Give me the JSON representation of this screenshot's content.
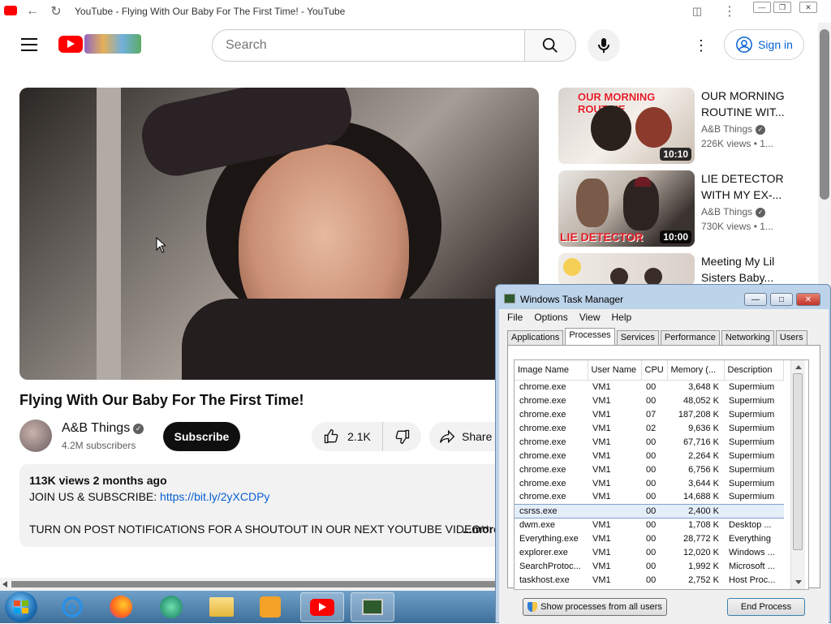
{
  "browser": {
    "title": "YouTube - Flying With Our Baby For The First Time! - YouTube"
  },
  "header": {
    "search_placeholder": "Search",
    "sign_in": "Sign in"
  },
  "video": {
    "title": "Flying With Our Baby For The First Time!",
    "channel": "A&B Things",
    "subscribers": "4.2M subscribers",
    "subscribe_label": "Subscribe",
    "likes": "2.1K",
    "share_label": "Share",
    "views_date": "113K views  2 months ago",
    "desc_line1": "JOIN US & SUBSCRIBE: ",
    "desc_link": "https://bit.ly/2yXCDPy",
    "desc_line2": "TURN ON POST NOTIFICATIONS FOR A SHOUTOUT IN OUR NEXT YOUTUBE VIDEO**",
    "more_label": "...more"
  },
  "suggestions": [
    {
      "title": "OUR MORNING ROUTINE WIT...",
      "channel": "A&B Things",
      "views": "226K views  • 1...",
      "duration": "10:10",
      "thumb_text": "OUR MORNING ROUTINE"
    },
    {
      "title": "LIE DETECTOR WITH MY EX-...",
      "channel": "A&B Things",
      "views": "730K views  • 1...",
      "duration": "10:00",
      "thumb_text": "LIE DETECTOR"
    },
    {
      "title": "Meeting My Lil Sisters Baby...",
      "channel": "",
      "views": "",
      "duration": "",
      "thumb_text": ""
    }
  ],
  "task_manager": {
    "title": "Windows Task Manager",
    "menu": [
      "File",
      "Options",
      "View",
      "Help"
    ],
    "tabs": [
      "Applications",
      "Processes",
      "Services",
      "Performance",
      "Networking",
      "Users"
    ],
    "selected_tab": "Processes",
    "columns": [
      "Image Name",
      "User Name",
      "CPU",
      "Memory (...",
      "Description"
    ],
    "rows": [
      [
        "chrome.exe",
        "VM1",
        "00",
        "3,648 K",
        "Supermium"
      ],
      [
        "chrome.exe",
        "VM1",
        "00",
        "48,052 K",
        "Supermium"
      ],
      [
        "chrome.exe",
        "VM1",
        "07",
        "187,208 K",
        "Supermium"
      ],
      [
        "chrome.exe",
        "VM1",
        "02",
        "9,636 K",
        "Supermium"
      ],
      [
        "chrome.exe",
        "VM1",
        "00",
        "67,716 K",
        "Supermium"
      ],
      [
        "chrome.exe",
        "VM1",
        "00",
        "2,264 K",
        "Supermium"
      ],
      [
        "chrome.exe",
        "VM1",
        "00",
        "6,756 K",
        "Supermium"
      ],
      [
        "chrome.exe",
        "VM1",
        "00",
        "3,644 K",
        "Supermium"
      ],
      [
        "chrome.exe",
        "VM1",
        "00",
        "14,688 K",
        "Supermium"
      ],
      [
        "csrss.exe",
        "",
        "00",
        "2,400 K",
        ""
      ],
      [
        "dwm.exe",
        "VM1",
        "00",
        "1,708 K",
        "Desktop ..."
      ],
      [
        "Everything.exe",
        "VM1",
        "00",
        "28,772 K",
        "Everything"
      ],
      [
        "explorer.exe",
        "VM1",
        "00",
        "12,020 K",
        "Windows ..."
      ],
      [
        "SearchProtoc...",
        "VM1",
        "00",
        "1,992 K",
        "Microsoft ..."
      ],
      [
        "taskhost.exe",
        "VM1",
        "00",
        "2,752 K",
        "Host Proc..."
      ]
    ],
    "selected_row": 9,
    "show_all_label": "Show processes from all users",
    "end_process_label": "End Process"
  },
  "colors": {
    "accent_red": "#ff0000",
    "link_blue": "#065fd4"
  }
}
